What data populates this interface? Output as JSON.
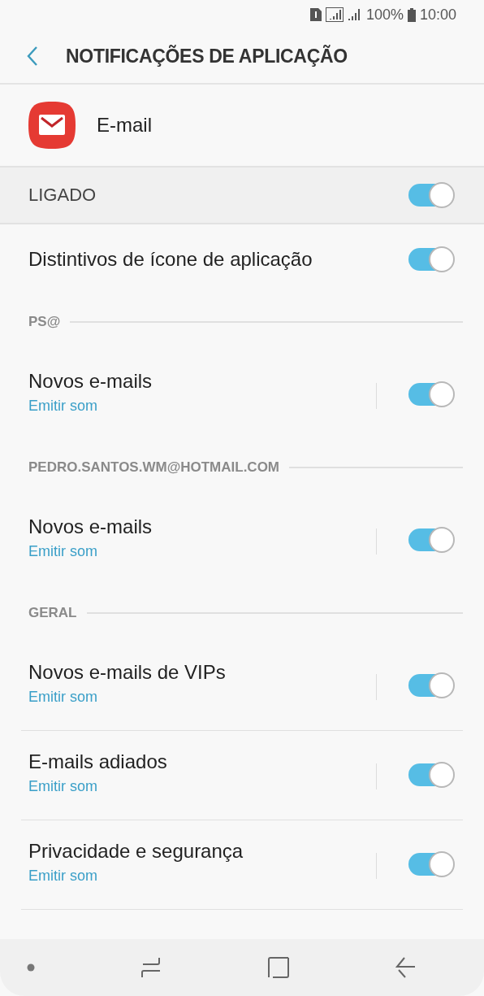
{
  "status_bar": {
    "battery": "100%",
    "time": "10:00"
  },
  "header": {
    "title": "NOTIFICAÇÕES DE APLICAÇÃO"
  },
  "app": {
    "name": "E-mail"
  },
  "master": {
    "label": "LIGADO",
    "on": true
  },
  "items": [
    {
      "kind": "switch",
      "title": "Distintivos de ícone de aplicação",
      "on": true
    },
    {
      "kind": "section",
      "title": "PS@"
    },
    {
      "kind": "channel",
      "title": "Novos e-mails",
      "subtitle": "Emitir som",
      "on": true
    },
    {
      "kind": "section",
      "title": "PEDRO.SANTOS.WM@HOTMAIL.COM"
    },
    {
      "kind": "channel",
      "title": "Novos e-mails",
      "subtitle": "Emitir som",
      "on": true
    },
    {
      "kind": "section",
      "title": "GERAL"
    },
    {
      "kind": "channel",
      "title": "Novos e-mails de VIPs",
      "subtitle": "Emitir som",
      "on": true
    },
    {
      "kind": "channel",
      "title": "E-mails adiados",
      "subtitle": "Emitir som",
      "on": true
    },
    {
      "kind": "channel",
      "title": "Privacidade e segurança",
      "subtitle": "Emitir som",
      "on": true
    }
  ]
}
